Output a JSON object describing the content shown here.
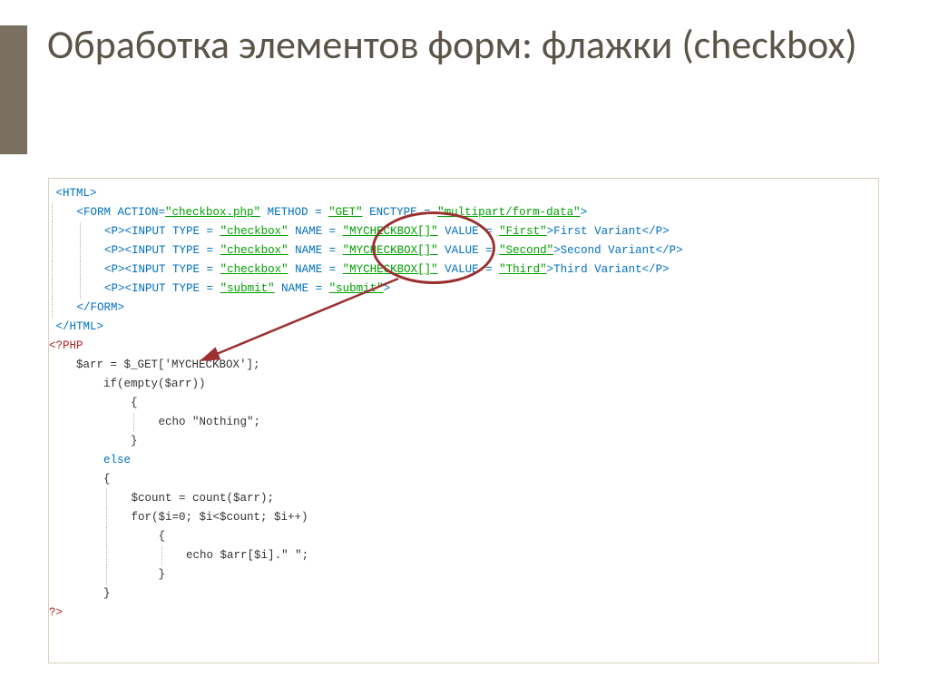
{
  "title": "Обработка элементов форм: флажки (checkbox)",
  "code": {
    "l01": "<HTML>",
    "l02a": "<FORM ACTION=",
    "l02b": "\"checkbox.php\"",
    "l02c": " METHOD = ",
    "l02d": "\"GET\"",
    "l02e": " ENCTYPE = ",
    "l02f": "\"multipart/form-data\"",
    "l02g": ">",
    "l03a": "<P><INPUT TYPE = ",
    "l03b": "\"checkbox\"",
    "l03c": " NAME = ",
    "l03d": "\"MYCHECKBOX[]\"",
    "l03e": " VALUE = ",
    "l03f": "\"First\"",
    "l03g": ">First Variant</P>",
    "l04a": "<P><INPUT TYPE = ",
    "l04b": "\"checkbox\"",
    "l04c": " NAME = ",
    "l04d": "\"MYCHECKBOX[]\"",
    "l04e": " VALUE = ",
    "l04f": "\"Second\"",
    "l04g": ">Second Variant</P>",
    "l05a": "<P><INPUT TYPE = ",
    "l05b": "\"checkbox\"",
    "l05c": " NAME = ",
    "l05d": "\"MYCHECKBOX[]\"",
    "l05e": " VALUE = ",
    "l05f": "\"Third\"",
    "l05g": ">Third Variant</P>",
    "l06a": "<P><INPUT TYPE = ",
    "l06b": "\"submit\"",
    "l06c": " NAME = ",
    "l06d": "\"submit\"",
    "l06e": ">",
    "l07": "</FORM>",
    "l08": "</HTML>",
    "l09": "<?PHP",
    "l10": "$arr = $_GET['MYCHECKBOX'];",
    "l11": "if(empty($arr))",
    "l12": "{",
    "l13": "echo \"Nothing\";",
    "l14": "}",
    "l15": "else",
    "l16": "{",
    "l17": "$count = count($arr);",
    "l18": "for($i=0; $i<$count; $i++)",
    "l19": "{",
    "l20": "echo $arr[$i].\" \";",
    "l21": "}",
    "l22": "}",
    "l23": "?>"
  }
}
